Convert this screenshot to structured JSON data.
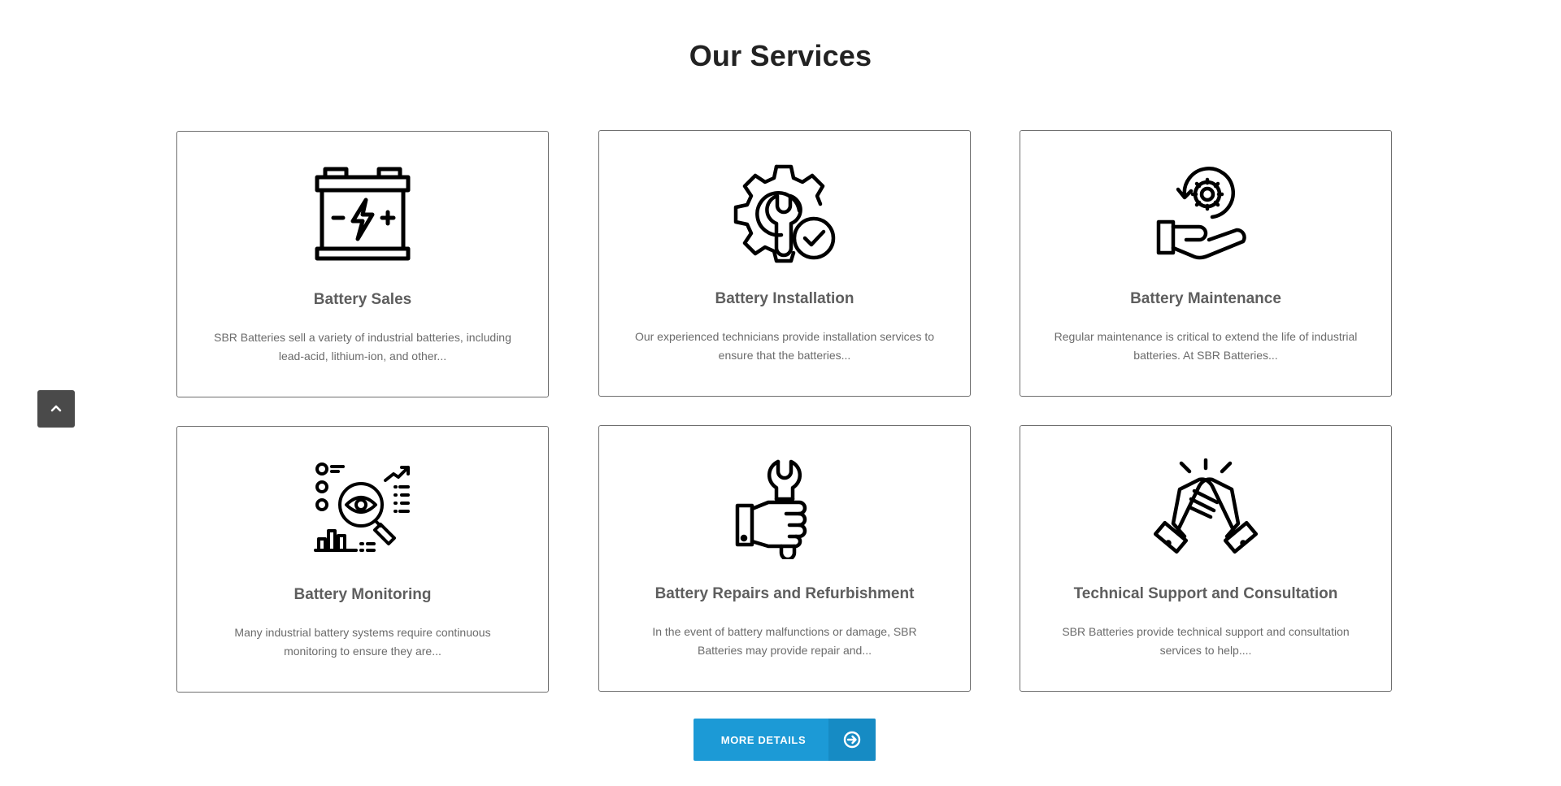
{
  "section": {
    "title": "Our Services"
  },
  "services": [
    {
      "title": "Battery Sales",
      "description": "SBR Batteries sell a variety of industrial batteries, including lead-acid, lithium-ion, and other...",
      "icon": "car-battery-icon"
    },
    {
      "title": "Battery Installation",
      "description": "Our experienced technicians provide installation services to ensure that the batteries...",
      "icon": "gear-wrench-check-icon"
    },
    {
      "title": "Battery Maintenance",
      "description": "Regular maintenance is critical to extend the life of industrial batteries. At SBR Batteries...",
      "icon": "hand-gear-icon"
    },
    {
      "title": "Battery Monitoring",
      "description": "Many industrial battery systems require continuous monitoring to ensure they are...",
      "icon": "monitoring-magnifier-icon"
    },
    {
      "title": "Battery Repairs and Refurbishment",
      "description": "In the event of battery malfunctions or damage, SBR Batteries may provide repair and...",
      "icon": "hand-wrench-icon"
    },
    {
      "title": "Technical Support and Consultation",
      "description": "SBR Batteries provide technical support and consultation services to help....",
      "icon": "handshake-icon"
    }
  ],
  "more_button": {
    "label": "MORE DETAILS",
    "icon": "arrow-circle-right-icon"
  },
  "scroll_top": {
    "icon": "chevron-up-icon"
  },
  "colors": {
    "accent": "#1c9ad6",
    "accent_dark": "#168bc4",
    "scroll_button": "#4a4a4a",
    "card_border": "#6f6f6f"
  }
}
